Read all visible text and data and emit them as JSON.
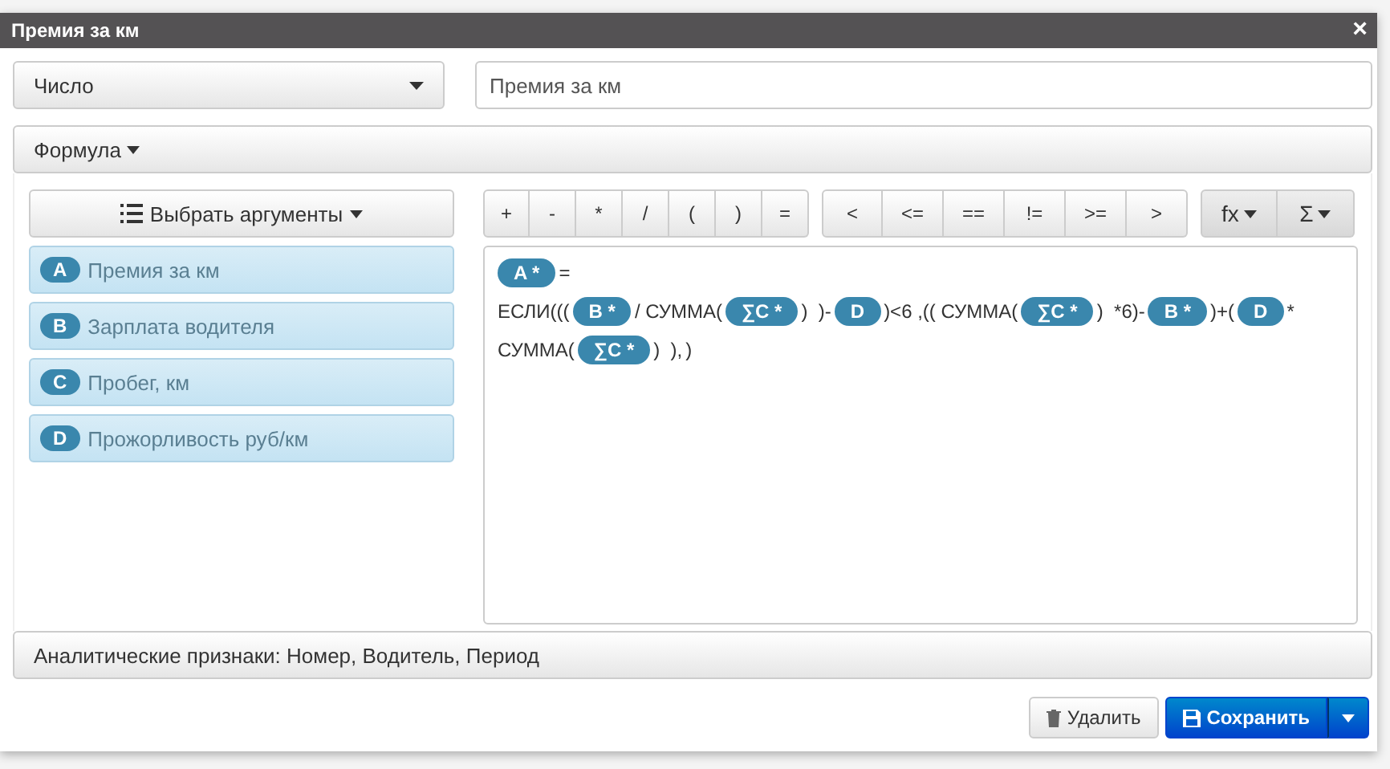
{
  "window": {
    "title": "Премия за км",
    "close": "×"
  },
  "type_select": {
    "value": "Число"
  },
  "name_field": {
    "value": "Премия за км"
  },
  "formula_bar": {
    "label": "Формула"
  },
  "args_button": {
    "label": "Выбрать аргументы"
  },
  "arguments": [
    {
      "letter": "A",
      "name": "Премия за км"
    },
    {
      "letter": "B",
      "name": "Зарплата водителя"
    },
    {
      "letter": "C",
      "name": "Пробег, км"
    },
    {
      "letter": "D",
      "name": "Прожорливость руб/км"
    }
  ],
  "operator_groups": [
    [
      "+",
      "-",
      "*",
      "/",
      "(",
      ")",
      "="
    ],
    [
      "<",
      "<=",
      "==",
      "!=",
      ">=",
      ">"
    ]
  ],
  "function_buttons": [
    {
      "label": "fx"
    },
    {
      "label": "Σ"
    }
  ],
  "formula_lines": [
    [
      {
        "kind": "chip",
        "text": "A *"
      },
      {
        "kind": "text",
        "text": "="
      }
    ],
    [
      {
        "kind": "text",
        "text": "ЕСЛИ((("
      },
      {
        "kind": "chip",
        "text": "B *"
      },
      {
        "kind": "text",
        "text": "/ СУММА("
      },
      {
        "kind": "chip",
        "text": "∑C *"
      },
      {
        "kind": "text",
        "text": ")  )-"
      },
      {
        "kind": "chip",
        "text": "D"
      },
      {
        "kind": "text",
        "text": ")<6 ,(( СУММА("
      },
      {
        "kind": "chip",
        "text": "∑C *"
      },
      {
        "kind": "text",
        "text": ")  *6)-"
      },
      {
        "kind": "chip",
        "text": "B *"
      },
      {
        "kind": "text",
        "text": ")+("
      },
      {
        "kind": "chip",
        "text": "D"
      },
      {
        "kind": "text",
        "text": "*"
      }
    ],
    [
      {
        "kind": "text",
        "text": "СУММА("
      },
      {
        "kind": "chip",
        "text": "∑C *"
      },
      {
        "kind": "text",
        "text": ")  ),"
      },
      {
        "kind": "text",
        "text": ")"
      }
    ]
  ],
  "analytics_bar": {
    "label": "Аналитические признаки: Номер, Водитель, Период"
  },
  "footer": {
    "delete": "Удалить",
    "save": "Сохранить"
  }
}
